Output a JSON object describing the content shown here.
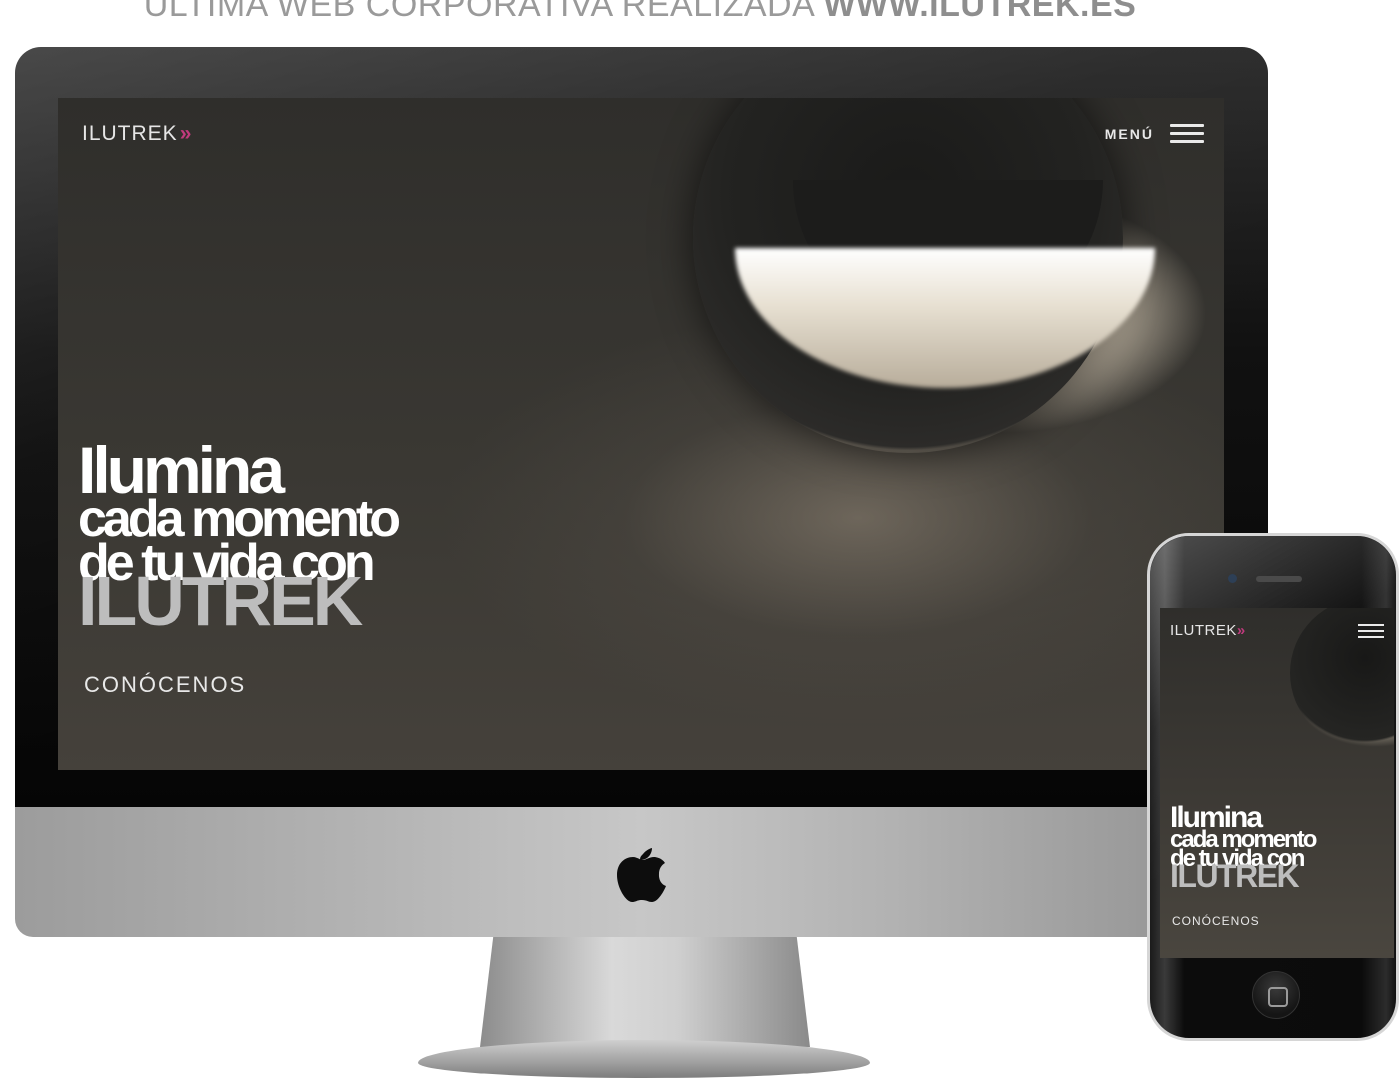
{
  "headline": {
    "prefix": "ÚLTIMA WEB CORPORATIVA REALIZADA",
    "url": "WWW.ILUTREK.ES"
  },
  "site": {
    "logo_text": "ILUTREK",
    "logo_mark": "»",
    "menu_label": "MENÚ",
    "menu_icon": "hamburger-icon",
    "hero": {
      "line1": "Ilumina",
      "line2": "cada momento",
      "line3": "de tu vida con",
      "line4": "ILUTREK"
    },
    "cta_label": "CONÓCENOS"
  },
  "colors": {
    "accent": "#c03a7d",
    "headline_text": "#9a9a9a",
    "hero_text": "#ffffff",
    "hero_brand": "#bdbdbd"
  },
  "devices": [
    "imac",
    "iphone"
  ],
  "icons": [
    "apple-logo-icon",
    "hamburger-icon",
    "home-button-icon"
  ]
}
